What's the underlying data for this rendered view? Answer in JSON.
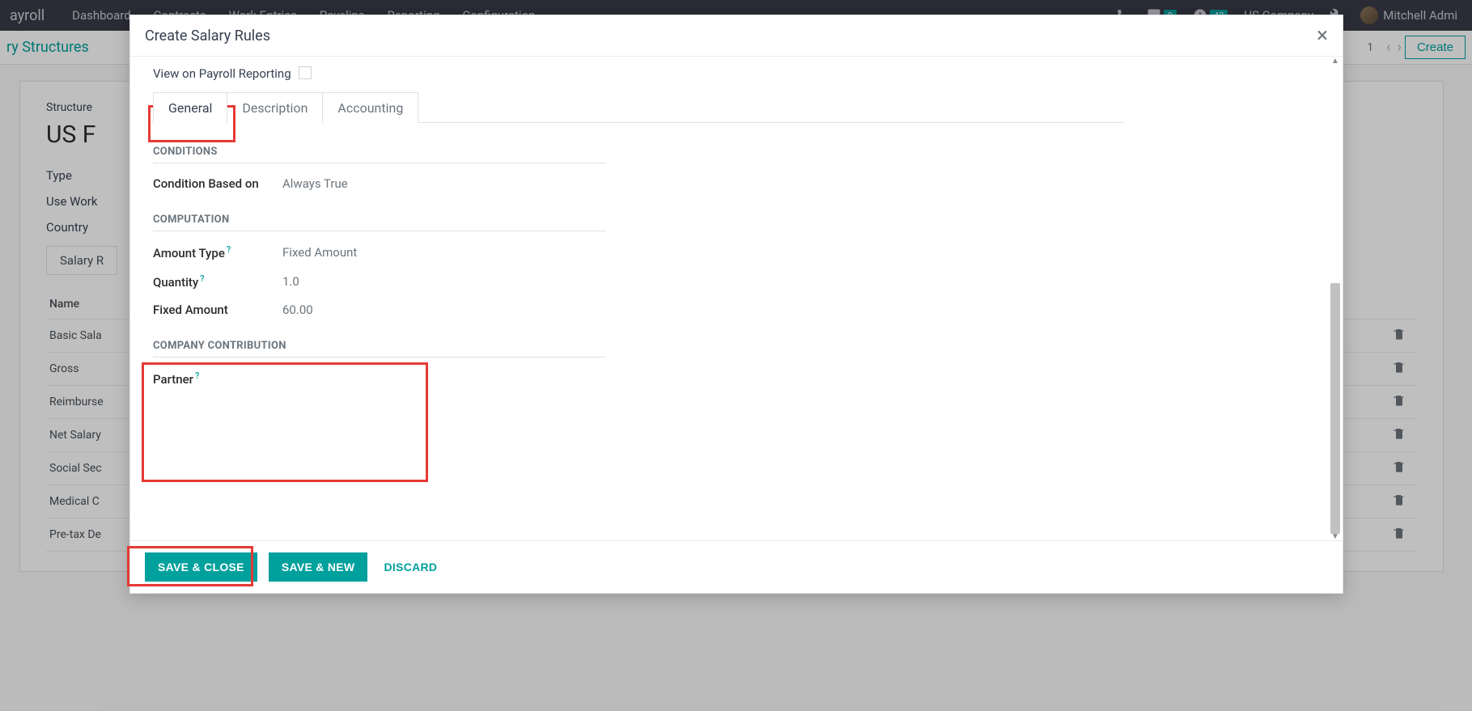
{
  "topnav": {
    "app": "ayroll",
    "items": [
      "Dashboard",
      "Contracts",
      "Work Entries",
      "Payslips",
      "Reporting",
      "Configuration"
    ],
    "msg_badge": "9",
    "clock_badge": "43",
    "company": "US Company",
    "user": "Mitchell Admi"
  },
  "subheader": {
    "breadcrumb": "ry Structures",
    "paging": "1",
    "create": "Create"
  },
  "form": {
    "structure_label": "Structure",
    "title_prefix": "US F",
    "type_label": "Type",
    "usework_label": "Use Work",
    "country_label": "Country",
    "tab_salary": "Salary R",
    "name_header": "Name",
    "rules": [
      "Basic Sala",
      "Gross",
      "Reimburse",
      "Net Salary",
      "Social Sec",
      "Medical C",
      "Pre-tax De"
    ]
  },
  "modal": {
    "title": "Create Salary Rules",
    "reporting_label": "View on Payroll Reporting",
    "tabs": {
      "general": "General",
      "description": "Description",
      "accounting": "Accounting"
    },
    "conditions_title": "CONDITIONS",
    "condition_label": "Condition Based on",
    "condition_value": "Always True",
    "computation_title": "COMPUTATION",
    "amount_type_label": "Amount Type",
    "amount_type_value": "Fixed Amount",
    "quantity_label": "Quantity",
    "quantity_value": "1.0",
    "fixed_amount_label": "Fixed Amount",
    "fixed_amount_value": "60.00",
    "contribution_title": "COMPANY CONTRIBUTION",
    "partner_label": "Partner",
    "footer": {
      "save_close": "SAVE & CLOSE",
      "save_new": "SAVE & NEW",
      "discard": "DISCARD"
    }
  }
}
